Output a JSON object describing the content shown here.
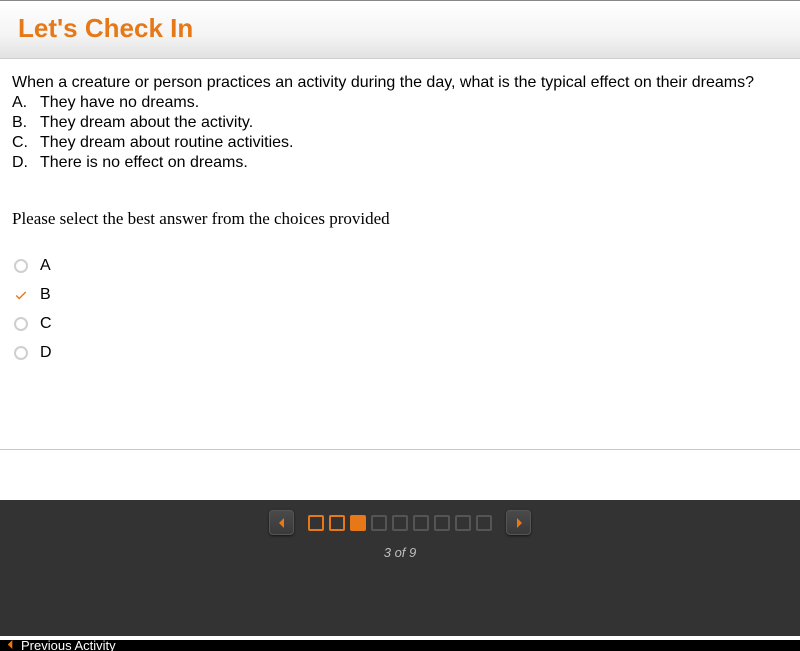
{
  "header": {
    "title": "Let's Check In"
  },
  "question": {
    "prompt": "When a creature or person practices an activity during the day, what is the typical effect on their dreams?",
    "options": [
      {
        "letter": "A.",
        "text": "They have no dreams."
      },
      {
        "letter": "B.",
        "text": "They dream about the activity."
      },
      {
        "letter": "C.",
        "text": "They dream about routine activities."
      },
      {
        "letter": "D.",
        "text": "There is no effect on dreams."
      }
    ],
    "instruction": "Please select the best answer from the choices provided"
  },
  "answers": [
    {
      "label": "A",
      "selected": false
    },
    {
      "label": "B",
      "selected": true
    },
    {
      "label": "C",
      "selected": false
    },
    {
      "label": "D",
      "selected": false
    }
  ],
  "pagination": {
    "current": 3,
    "total": 9,
    "indicator": "3 of 9",
    "states": [
      "completed",
      "completed",
      "current",
      "upcoming",
      "upcoming",
      "upcoming",
      "upcoming",
      "upcoming",
      "upcoming"
    ]
  },
  "footer": {
    "prev_label": "Previous Activity"
  }
}
